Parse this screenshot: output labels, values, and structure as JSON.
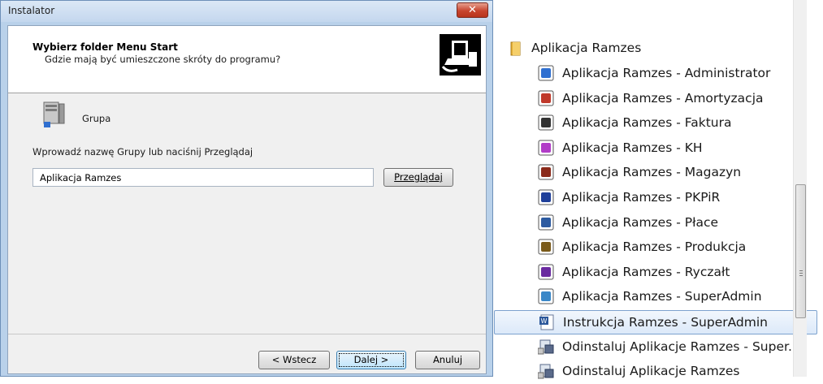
{
  "window": {
    "title": "Instalator",
    "close_label": "✕"
  },
  "header": {
    "title": "Wybierz folder Menu Start",
    "subtitle": "Gdzie mają być umieszczone skróty do programu?"
  },
  "group": {
    "label": "Grupa",
    "prompt": "Wprowadź nazwę Grupy lub naciśnij Przeglądaj",
    "input_value": "Aplikacja Ramzes",
    "browse_label": "Przeglądaj"
  },
  "footer": {
    "back_label": "< Wstecz",
    "next_label": "Dalej >",
    "cancel_label": "Anuluj"
  },
  "start_menu": {
    "folder": "Aplikacja Ramzes",
    "items": [
      {
        "label": "Aplikacja Ramzes - Administrator",
        "icon": "administrator-icon",
        "color": "#2f6fd0"
      },
      {
        "label": "Aplikacja Ramzes - Amortyzacja",
        "icon": "amortyzacja-icon",
        "color": "#c0392b"
      },
      {
        "label": "Aplikacja Ramzes - Faktura",
        "icon": "faktura-icon",
        "color": "#333333"
      },
      {
        "label": "Aplikacja Ramzes - KH",
        "icon": "kh-icon",
        "color": "#b13cc7"
      },
      {
        "label": "Aplikacja Ramzes - Magazyn",
        "icon": "magazyn-icon",
        "color": "#8b2a1a"
      },
      {
        "label": "Aplikacja Ramzes - PKPiR",
        "icon": "pkpir-icon",
        "color": "#1f3f9a"
      },
      {
        "label": "Aplikacja Ramzes - Płace",
        "icon": "place-icon",
        "color": "#2c5aa0"
      },
      {
        "label": "Aplikacja Ramzes - Produkcja",
        "icon": "produkcja-icon",
        "color": "#7a5a1a"
      },
      {
        "label": "Aplikacja Ramzes - Ryczałt",
        "icon": "ryczalt-icon",
        "color": "#6a2aa0"
      },
      {
        "label": "Aplikacja Ramzes - SuperAdmin",
        "icon": "superadmin-icon",
        "color": "#3a87c8"
      },
      {
        "label": "Instrukcja Ramzes - SuperAdmin",
        "icon": "word-document-icon",
        "color": "#2b579a",
        "selected": true
      },
      {
        "label": "Odinstaluj Aplikacje Ramzes - Super...",
        "icon": "uninstall-icon",
        "color": "#5a6a8a"
      },
      {
        "label": "Odinstaluj Aplikacje Ramzes",
        "icon": "uninstall-icon",
        "color": "#5a6a8a"
      }
    ]
  }
}
